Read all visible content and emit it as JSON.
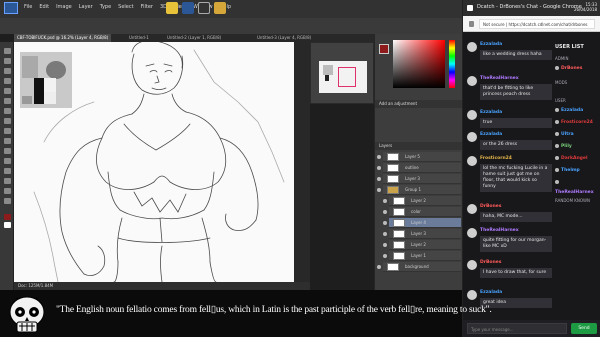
{
  "photoshop": {
    "menu": [
      "File",
      "Edit",
      "Image",
      "Layer",
      "Type",
      "Select",
      "Filter",
      "3D",
      "View",
      "Window",
      "Help"
    ],
    "taskbar_icons": [
      "chrome-icon",
      "photoshop-icon",
      "obs-icon",
      "folder-icon"
    ],
    "doc_tabs": [
      "CBF-TOBIFUCK.psd @ 16.2% (Layer 4, RGB/8)",
      "Untitled-1",
      "Untitled-2 (Layer 1, RGB/8)",
      "Untitled-3 (Layer 4, RGB/8)"
    ],
    "status": "Doc: 125M/1.84M",
    "adjustments_header": "Add an adjustment",
    "layers_header": "Layers",
    "layers": [
      "Layer 5",
      "outline",
      "Layer 3",
      "Group 1",
      "Layer 2",
      "color",
      "Layer 4",
      "Layer 3",
      "Layer 2",
      "Layer 1",
      "background"
    ]
  },
  "chrome": {
    "title": "Dcatch - DrBones's Chat - Google Chrome",
    "clock": "15:33",
    "date": "26/04/2018",
    "address": "Not secure | https://dcatch.cdlnet.com/chat/drbones",
    "chat": {
      "messages": [
        {
          "user": "Ezzalada",
          "color": "#4aa3ff",
          "text": "like a wedding dress haha"
        },
        {
          "user": "TheRealHarnex",
          "color": "#b07bff",
          "text": "that'd be fitting to like princess peach dress"
        },
        {
          "user": "Ezzalada",
          "color": "#4aa3ff",
          "text": "true"
        },
        {
          "user": "Ezzalada",
          "color": "#4aa3ff",
          "text": "or the 26 dress"
        },
        {
          "user": "Frosticorn24",
          "color": "#e8b84a",
          "text": "lol the mc fucking Lucile in a hame suit just got me on floor, that would kick so funny"
        },
        {
          "user": "DrBones",
          "color": "#ff5a5a",
          "text": "haha, MC mode..."
        },
        {
          "user": "TheRealHarnex",
          "color": "#b07bff",
          "text": "quite fitting for our morgan-like MC xD"
        },
        {
          "user": "DrBones",
          "color": "#ff5a5a",
          "text": "I have to draw that, for sure"
        },
        {
          "user": "Ezzalada",
          "color": "#4aa3ff",
          "text": "great idea"
        }
      ],
      "userlist_title": "USER LIST",
      "sections": [
        "ADMIN",
        "MODS",
        "USER"
      ],
      "admin": "DrBones",
      "users": [
        {
          "name": "Ezzalada",
          "color": "#4aa3ff"
        },
        {
          "name": "Frosticorn24",
          "color": "#e03a3a"
        },
        {
          "name": "Ultra",
          "color": "#4aa3ff"
        },
        {
          "name": "Plily",
          "color": "#7ad07a"
        },
        {
          "name": "DarkAngel",
          "color": "#e03a3a"
        },
        {
          "name": "Thelmp",
          "color": "#4aa3ff"
        },
        {
          "name": "TheRealHarnex",
          "color": "#b07bff"
        }
      ],
      "anon": "RANDOM KNOWN",
      "input_placeholder": "Type your message...",
      "send_label": "Send"
    }
  },
  "caption": "\"The English noun fellatio comes from fell▯us, which in Latin is the past participle of the verb fell▯re, meaning to suck\"."
}
